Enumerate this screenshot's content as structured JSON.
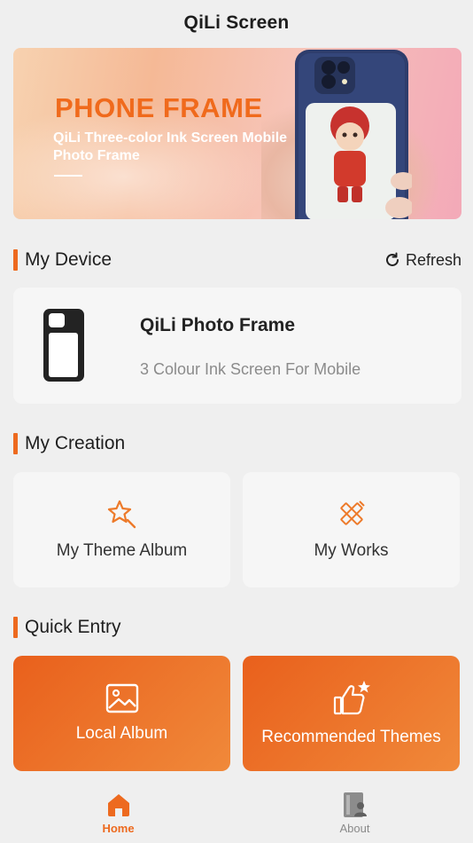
{
  "header": {
    "title": "QiLi Screen"
  },
  "banner": {
    "title": "PHONE FRAME",
    "subtitle": "QiLi Three-color Ink Screen Mobile Photo Frame"
  },
  "my_device": {
    "title": "My Device",
    "refresh_label": "Refresh",
    "device_name": "QiLi Photo Frame",
    "device_desc": "3 Colour Ink Screen For Mobile"
  },
  "my_creation": {
    "title": "My Creation",
    "items": [
      {
        "label": "My Theme Album",
        "icon": "star-pencil-icon"
      },
      {
        "label": "My Works",
        "icon": "pencil-ruler-icon"
      }
    ]
  },
  "quick_entry": {
    "title": "Quick Entry",
    "items": [
      {
        "label": "Local Album",
        "icon": "image-icon"
      },
      {
        "label": "Recommended Themes",
        "icon": "thumbs-up-star-icon"
      }
    ]
  },
  "tabbar": {
    "items": [
      {
        "label": "Home",
        "icon": "home-icon",
        "active": true
      },
      {
        "label": "About",
        "icon": "about-icon",
        "active": false
      }
    ]
  },
  "colors": {
    "accent": "#ed6a1f",
    "background": "#efefef",
    "card": "#f6f6f6"
  }
}
